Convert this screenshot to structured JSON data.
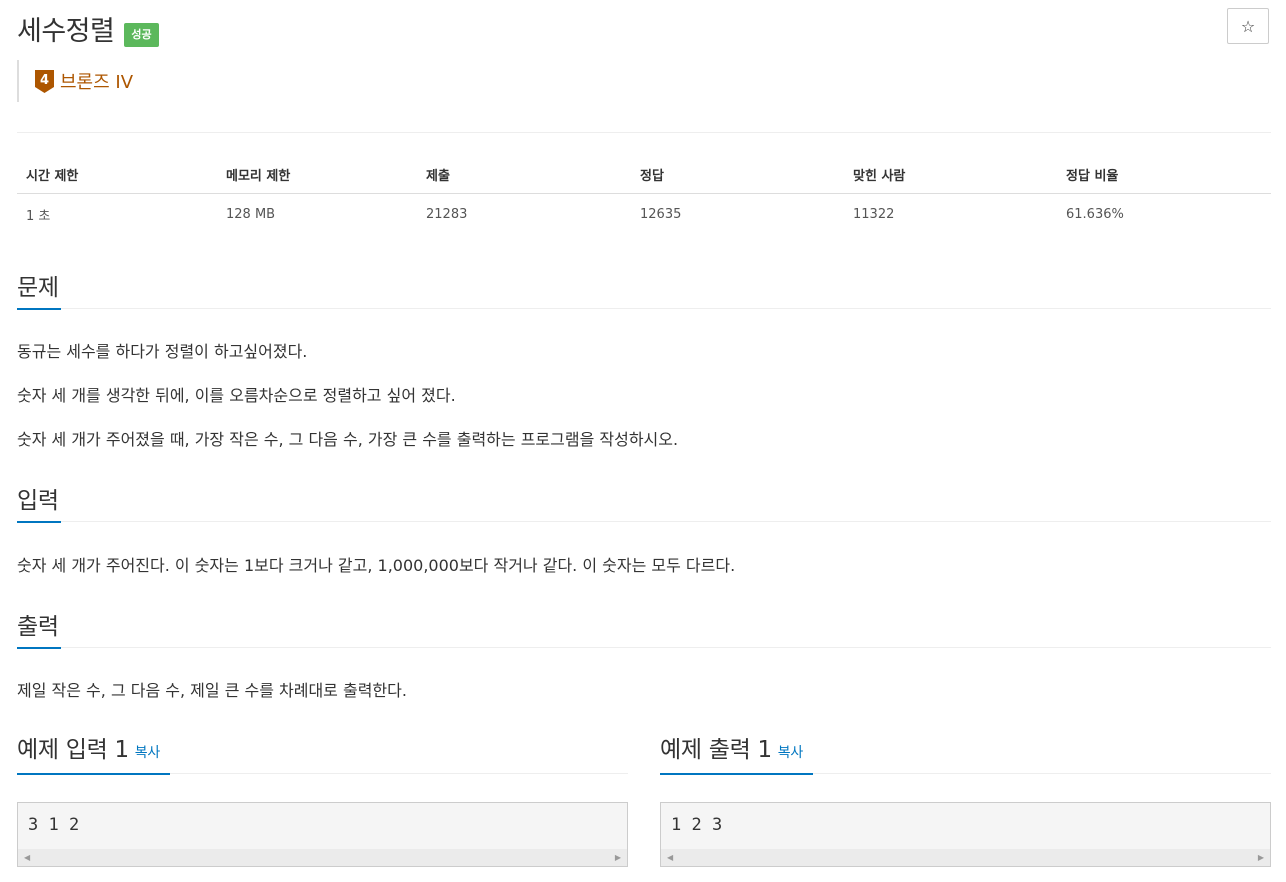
{
  "problem": {
    "title": "세수정렬",
    "status_badge": "성공",
    "star_icon": "☆",
    "tier": {
      "number": "4",
      "label": "브론즈 IV",
      "color": "#ad5600"
    }
  },
  "info_table": {
    "headers": [
      "시간 제한",
      "메모리 제한",
      "제출",
      "정답",
      "맞힌 사람",
      "정답 비율"
    ],
    "values": [
      "1 초",
      "128 MB",
      "21283",
      "12635",
      "11322",
      "61.636%"
    ]
  },
  "sections": {
    "description": {
      "heading": "문제",
      "paragraphs": [
        "동규는 세수를 하다가 정렬이 하고싶어졌다.",
        "숫자 세 개를 생각한 뒤에, 이를 오름차순으로 정렬하고 싶어 졌다.",
        "숫자 세 개가 주어졌을 때, 가장 작은 수, 그 다음 수, 가장 큰 수를 출력하는 프로그램을 작성하시오."
      ]
    },
    "input": {
      "heading": "입력",
      "text": "숫자 세 개가 주어진다. 이 숫자는 1보다 크거나 같고, 1,000,000보다 작거나 같다. 이 숫자는 모두 다르다."
    },
    "output": {
      "heading": "출력",
      "text": "제일 작은 수, 그 다음 수, 제일 큰 수를 차례대로 출력한다."
    }
  },
  "examples": {
    "input": {
      "heading": "예제 입력 1",
      "copy_label": "복사",
      "content": "3 1 2"
    },
    "output": {
      "heading": "예제 출력 1",
      "copy_label": "복사",
      "content": "1 2 3"
    }
  },
  "colors": {
    "accent": "#0076c0",
    "success": "#5cb85c"
  }
}
